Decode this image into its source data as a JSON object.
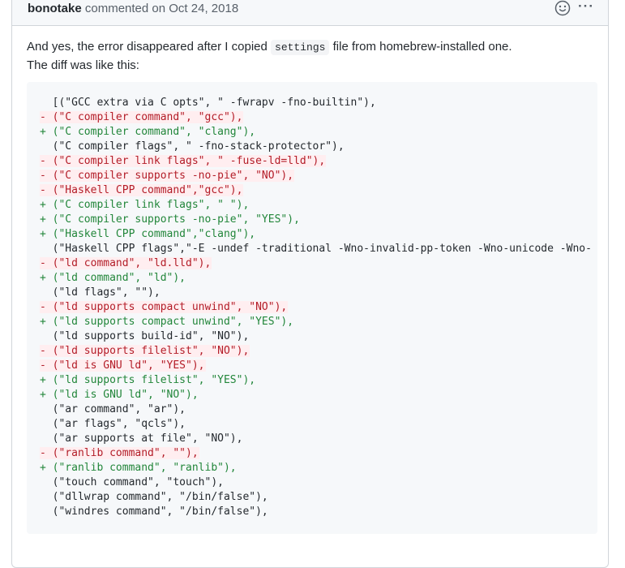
{
  "comment": {
    "author": "bonotake",
    "action": "commented on",
    "date": "Oct 24, 2018",
    "more_label": "···",
    "body_line1_before": "And yes, the error disappeared after I copied",
    "body_code": "settings",
    "body_line1_after": "file from homebrew-installed one.",
    "body_line2": "The diff was like this:"
  },
  "diff_lines": [
    {
      "type": "ctx",
      "text": "  [(\"GCC extra via C opts\", \" -fwrapv -fno-builtin\"),"
    },
    {
      "type": "del",
      "text": "- (\"C compiler command\", \"gcc\"),"
    },
    {
      "type": "add",
      "text": "+ (\"C compiler command\", \"clang\"),"
    },
    {
      "type": "ctx",
      "text": "  (\"C compiler flags\", \" -fno-stack-protector\"),"
    },
    {
      "type": "del",
      "text": "- (\"C compiler link flags\", \" -fuse-ld=lld\"),"
    },
    {
      "type": "del",
      "text": "- (\"C compiler supports -no-pie\", \"NO\"),"
    },
    {
      "type": "del",
      "text": "- (\"Haskell CPP command\",\"gcc\"),"
    },
    {
      "type": "add",
      "text": "+ (\"C compiler link flags\", \" \"),"
    },
    {
      "type": "add",
      "text": "+ (\"C compiler supports -no-pie\", \"YES\"),"
    },
    {
      "type": "add",
      "text": "+ (\"Haskell CPP command\",\"clang\"),"
    },
    {
      "type": "ctx",
      "text": "  (\"Haskell CPP flags\",\"-E -undef -traditional -Wno-invalid-pp-token -Wno-unicode -Wno-"
    },
    {
      "type": "del",
      "text": "- (\"ld command\", \"ld.lld\"),"
    },
    {
      "type": "add",
      "text": "+ (\"ld command\", \"ld\"),"
    },
    {
      "type": "ctx",
      "text": "  (\"ld flags\", \"\"),"
    },
    {
      "type": "del",
      "text": "- (\"ld supports compact unwind\", \"NO\"),"
    },
    {
      "type": "add",
      "text": "+ (\"ld supports compact unwind\", \"YES\"),"
    },
    {
      "type": "ctx",
      "text": "  (\"ld supports build-id\", \"NO\"),"
    },
    {
      "type": "del",
      "text": "- (\"ld supports filelist\", \"NO\"),"
    },
    {
      "type": "del",
      "text": "- (\"ld is GNU ld\", \"YES\"),"
    },
    {
      "type": "add",
      "text": "+ (\"ld supports filelist\", \"YES\"),"
    },
    {
      "type": "add",
      "text": "+ (\"ld is GNU ld\", \"NO\"),"
    },
    {
      "type": "ctx",
      "text": "  (\"ar command\", \"ar\"),"
    },
    {
      "type": "ctx",
      "text": "  (\"ar flags\", \"qcls\"),"
    },
    {
      "type": "ctx",
      "text": "  (\"ar supports at file\", \"NO\"),"
    },
    {
      "type": "del",
      "text": "- (\"ranlib command\", \"\"),"
    },
    {
      "type": "add",
      "text": "+ (\"ranlib command\", \"ranlib\"),"
    },
    {
      "type": "ctx",
      "text": "  (\"touch command\", \"touch\"),"
    },
    {
      "type": "ctx",
      "text": "  (\"dllwrap command\", \"/bin/false\"),"
    },
    {
      "type": "ctx",
      "text": "  (\"windres command\", \"/bin/false\"),"
    }
  ],
  "icons": {
    "emoji": "smiley-icon",
    "more": "kebab-horizontal-icon"
  },
  "colors": {
    "del_bg": "#ffeef0",
    "del_text": "#b31d28",
    "add_text": "#22863a"
  }
}
